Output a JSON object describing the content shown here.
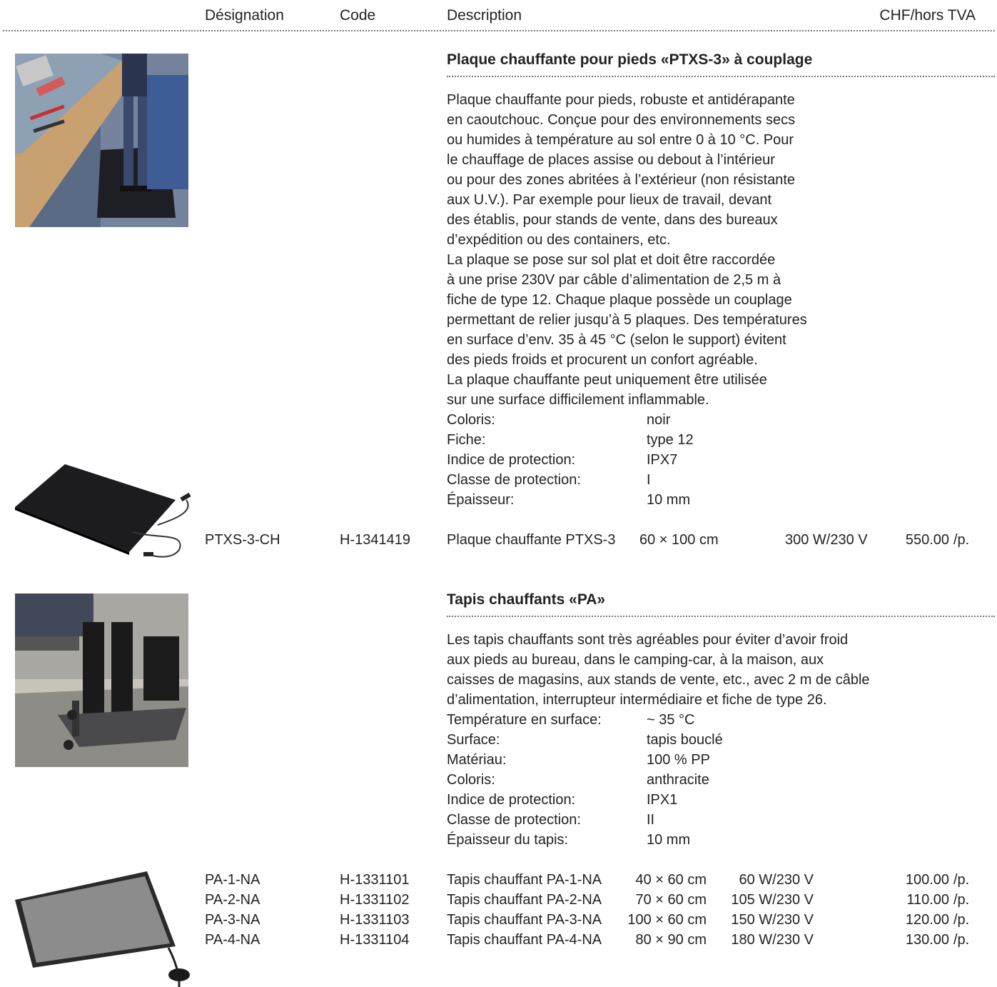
{
  "header": {
    "designation": "Désignation",
    "code": "Code",
    "description": "Description",
    "price": "CHF/hors TVA"
  },
  "products": [
    {
      "title": "Plaque chauffante pour pieds «PTXS-3» à couplage",
      "description": [
        "Plaque chauffante pour pieds, robuste et antidérapante",
        "en caoutchouc. Conçue pour des environnements secs",
        "ou humides à température au sol entre 0 à 10 °C. Pour",
        "le chauffage de places assise ou debout à l’intérieur",
        "ou pour des zones abritées à l’extérieur (non résistante",
        "aux U.V.). Par exemple pour lieux de travail, devant",
        "des établis, pour stands de vente, dans des bureaux",
        "d’expédition ou des containers, etc.",
        "La plaque se pose sur sol plat et doit être raccordée",
        "à une prise 230V par câble d’alimentation de 2,5 m à",
        "fiche de type 12. Chaque plaque possède un couplage",
        "permettant de relier jusqu’à 5 plaques. Des températures",
        "en surface d’env. 35 à 45 °C (selon le support) évitent",
        "des pieds froids et procurent un confort agréable.",
        "La plaque chauffante peut uniquement être utilisée",
        "sur une surface difficilement inflammable."
      ],
      "specs": [
        {
          "label": "Coloris:",
          "value": "noir"
        },
        {
          "label": "Fiche:",
          "value": "type 12"
        },
        {
          "label": "Indice de protection:",
          "value": "IPX7"
        },
        {
          "label": "Classe de protection:",
          "value": "I"
        },
        {
          "label": "Épaisseur:",
          "value": "10 mm"
        }
      ],
      "rows": [
        {
          "designation": "PTXS-3-CH",
          "code": "H-1341419",
          "name": "Plaque chauffante PTXS-3",
          "size": "60 × 100 cm",
          "power": "300 W/230 V",
          "price": "550.00",
          "unit": "/p."
        }
      ]
    },
    {
      "title": "Tapis chauffants «PA»",
      "description": [
        "Les tapis chauffants sont très agréables pour éviter d’avoir froid",
        "aux pieds au bureau, dans le camping-car, à la maison, aux",
        "caisses de magasins, aux stands de vente, etc., avec 2 m de câble",
        "d’alimentation, interrupteur intermédiaire et fiche de type 26."
      ],
      "specs": [
        {
          "label": "Température en surface:",
          "value": "~ 35 °C"
        },
        {
          "label": "Surface:",
          "value": "tapis bouclé"
        },
        {
          "label": "Matériau:",
          "value": "100 % PP"
        },
        {
          "label": "Coloris:",
          "value": "anthracite"
        },
        {
          "label": "Indice de protection:",
          "value": "IPX1"
        },
        {
          "label": "Classe de protection:",
          "value": "II"
        },
        {
          "label": "Épaisseur du tapis:",
          "value": "10 mm"
        }
      ],
      "rows": [
        {
          "designation": "PA-1-NA",
          "code": "H-1331101",
          "name": "Tapis chauffant PA-1-NA",
          "size": "40 × 60 cm",
          "power": "60 W/230 V",
          "price": "100.00",
          "unit": "/p."
        },
        {
          "designation": "PA-2-NA",
          "code": "H-1331102",
          "name": "Tapis chauffant PA-2-NA",
          "size": "70 × 60 cm",
          "power": "105 W/230 V",
          "price": "110.00",
          "unit": "/p."
        },
        {
          "designation": "PA-3-NA",
          "code": "H-1331103",
          "name": "Tapis chauffant PA-3-NA",
          "size": "100 × 60 cm",
          "power": "150 W/230 V",
          "price": "120.00",
          "unit": "/p."
        },
        {
          "designation": "PA-4-NA",
          "code": "H-1331104",
          "name": "Tapis chauffant PA-4-NA",
          "size": "80 × 90 cm",
          "power": "180 W/230 V",
          "price": "130.00",
          "unit": "/p."
        }
      ]
    }
  ]
}
